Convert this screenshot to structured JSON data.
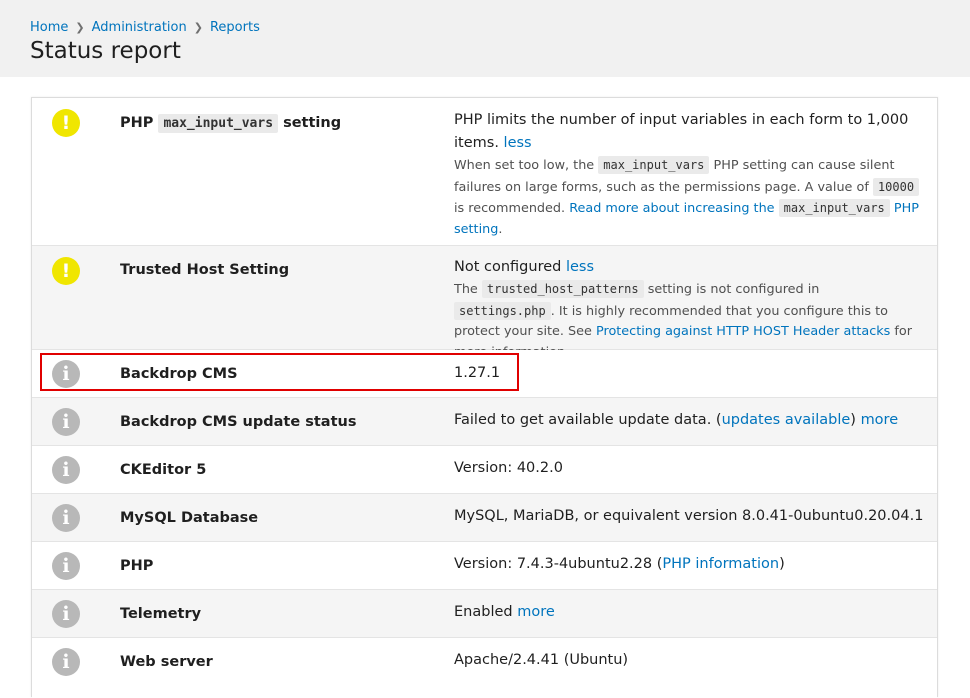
{
  "breadcrumb": [
    "Home",
    "Administration",
    "Reports"
  ],
  "page_title": "Status report",
  "rows": [
    {
      "title_pre": "PHP",
      "title_code": "max_input_vars",
      "title_post": "setting",
      "severity": "warning",
      "icon": "warning-icon",
      "value": "PHP limits the number of input variables in each form to 1,000 items.",
      "value_link": "less",
      "desc_1": "When set too low, the",
      "desc_code_1": "max_input_vars",
      "desc_2": "PHP setting can cause silent failures on large forms, such as the permissions page. A value of",
      "desc_code_2": "10000",
      "desc_3": "is recommended.",
      "desc_link": "Read more about increasing the",
      "desc_link_code": "max_input_vars",
      "desc_link_end": "PHP setting",
      "desc_end": "."
    },
    {
      "title": "Trusted Host Setting",
      "severity": "warning",
      "icon": "warning-icon",
      "value": "Not configured",
      "value_link": "less",
      "desc_1": "The",
      "desc_code_1": "trusted_host_patterns",
      "desc_2": "setting is not configured in",
      "desc_code_2": "settings.php",
      "desc_3": ". It is highly recommended that you configure this to protect your site. See",
      "desc_link": "Protecting against HTTP HOST Header attacks",
      "desc_end": "for more information."
    },
    {
      "title": "Backdrop CMS",
      "severity": "info",
      "icon": "info-icon",
      "value": "1.27.1"
    },
    {
      "title": "Backdrop CMS update status",
      "severity": "info",
      "icon": "info-icon",
      "value": "Failed to get available update data. (",
      "value_link": "updates available",
      "value_mid": ")",
      "value_link_2": "more"
    },
    {
      "title": "CKEditor 5",
      "severity": "info",
      "icon": "info-icon",
      "value": "Version: 40.2.0"
    },
    {
      "title": "MySQL Database",
      "severity": "info",
      "icon": "info-icon",
      "value": "MySQL, MariaDB, or equivalent version 8.0.41-0ubuntu0.20.04.1"
    },
    {
      "title": "PHP",
      "severity": "info",
      "icon": "info-icon",
      "value": "Version: 7.4.3-4ubuntu2.28 (",
      "value_link": "PHP information",
      "value_mid": ")"
    },
    {
      "title": "Telemetry",
      "severity": "info",
      "icon": "info-icon",
      "value": "Enabled",
      "value_link": "more"
    },
    {
      "title": "Web server",
      "severity": "info",
      "icon": "info-icon",
      "value": "Apache/2.4.41 (Ubuntu)"
    }
  ],
  "colors": {
    "link": "#0074bd",
    "warning": "#f0e600",
    "info": "#b8b8b8",
    "highlight": "#e00000"
  }
}
